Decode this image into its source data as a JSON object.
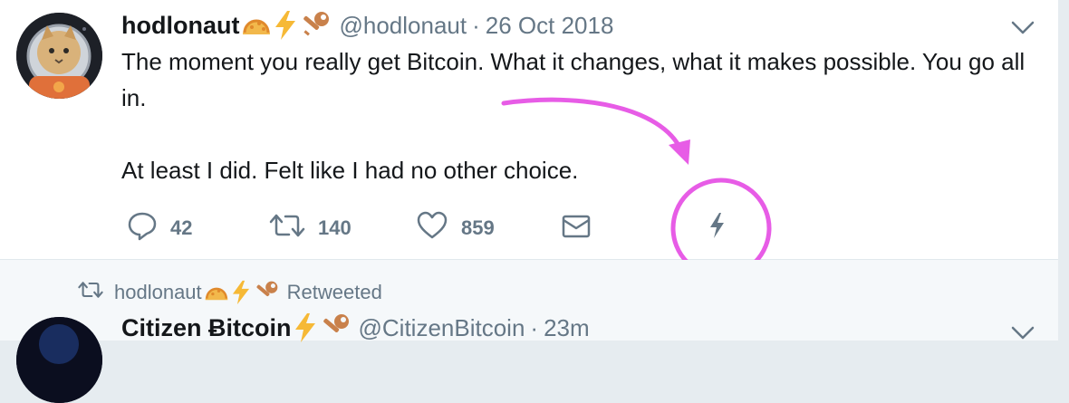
{
  "tweet": {
    "author_name": "hodlonaut",
    "handle": "@hodlonaut",
    "separator": "·",
    "date": "26 Oct 2018",
    "text_line1": "The moment you really get Bitcoin. What it changes, what it makes possible. You go all in.",
    "text_line2": "At least I did. Felt like I had no other choice.",
    "badges": [
      "taco-emoji",
      "lightning-emoji",
      "key-emoji"
    ],
    "actions": {
      "reply_count": "42",
      "retweet_count": "140",
      "like_count": "859"
    }
  },
  "retweet_context": {
    "name": "hodlonaut",
    "label": "Retweeted"
  },
  "tweet2": {
    "author_name": "Citizen Ƀitcoin",
    "handle": "@CitizenBitcoin",
    "separator": "·",
    "time": "23m"
  },
  "colors": {
    "secondary_text": "#657786",
    "annotation": "#e75ce6",
    "lightning": "#f6b936"
  }
}
